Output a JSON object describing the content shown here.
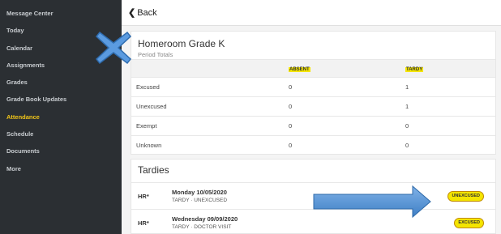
{
  "sidebar": {
    "items": [
      {
        "label": "Message Center"
      },
      {
        "label": "Today"
      },
      {
        "label": "Calendar"
      },
      {
        "label": "Assignments"
      },
      {
        "label": "Grades"
      },
      {
        "label": "Grade Book Updates"
      },
      {
        "label": "Attendance"
      },
      {
        "label": "Schedule"
      },
      {
        "label": "Documents"
      },
      {
        "label": "More"
      }
    ],
    "active_index": 6
  },
  "topbar": {
    "back_label": "Back"
  },
  "period_card": {
    "title": "Homeroom Grade K",
    "subtitle": "Period Totals",
    "columns": [
      "ABSENT",
      "TARDY"
    ],
    "rows": [
      {
        "label": "Excused",
        "absent": "0",
        "tardy": "1"
      },
      {
        "label": "Unexcused",
        "absent": "0",
        "tardy": "1"
      },
      {
        "label": "Exempt",
        "absent": "0",
        "tardy": "0"
      },
      {
        "label": "Unknown",
        "absent": "0",
        "tardy": "0"
      }
    ]
  },
  "tardies": {
    "title": "Tardies",
    "items": [
      {
        "code": "HR*",
        "date": "Monday 10/05/2020",
        "detail": "TARDY · UNEXCUSED",
        "badge": "UNEXCUSED"
      },
      {
        "code": "HR*",
        "date": "Wednesday 09/09/2020",
        "detail": "TARDY · DOCTOR VISIT",
        "badge": "EXCUSED"
      }
    ]
  },
  "colors": {
    "sidebar_bg": "#2b2f33",
    "active_nav": "#f0c419",
    "highlight": "#f4e500",
    "annotation_blue": "#4a86c8"
  },
  "annotations": [
    "x-mark-icon",
    "arrow-right-icon"
  ]
}
